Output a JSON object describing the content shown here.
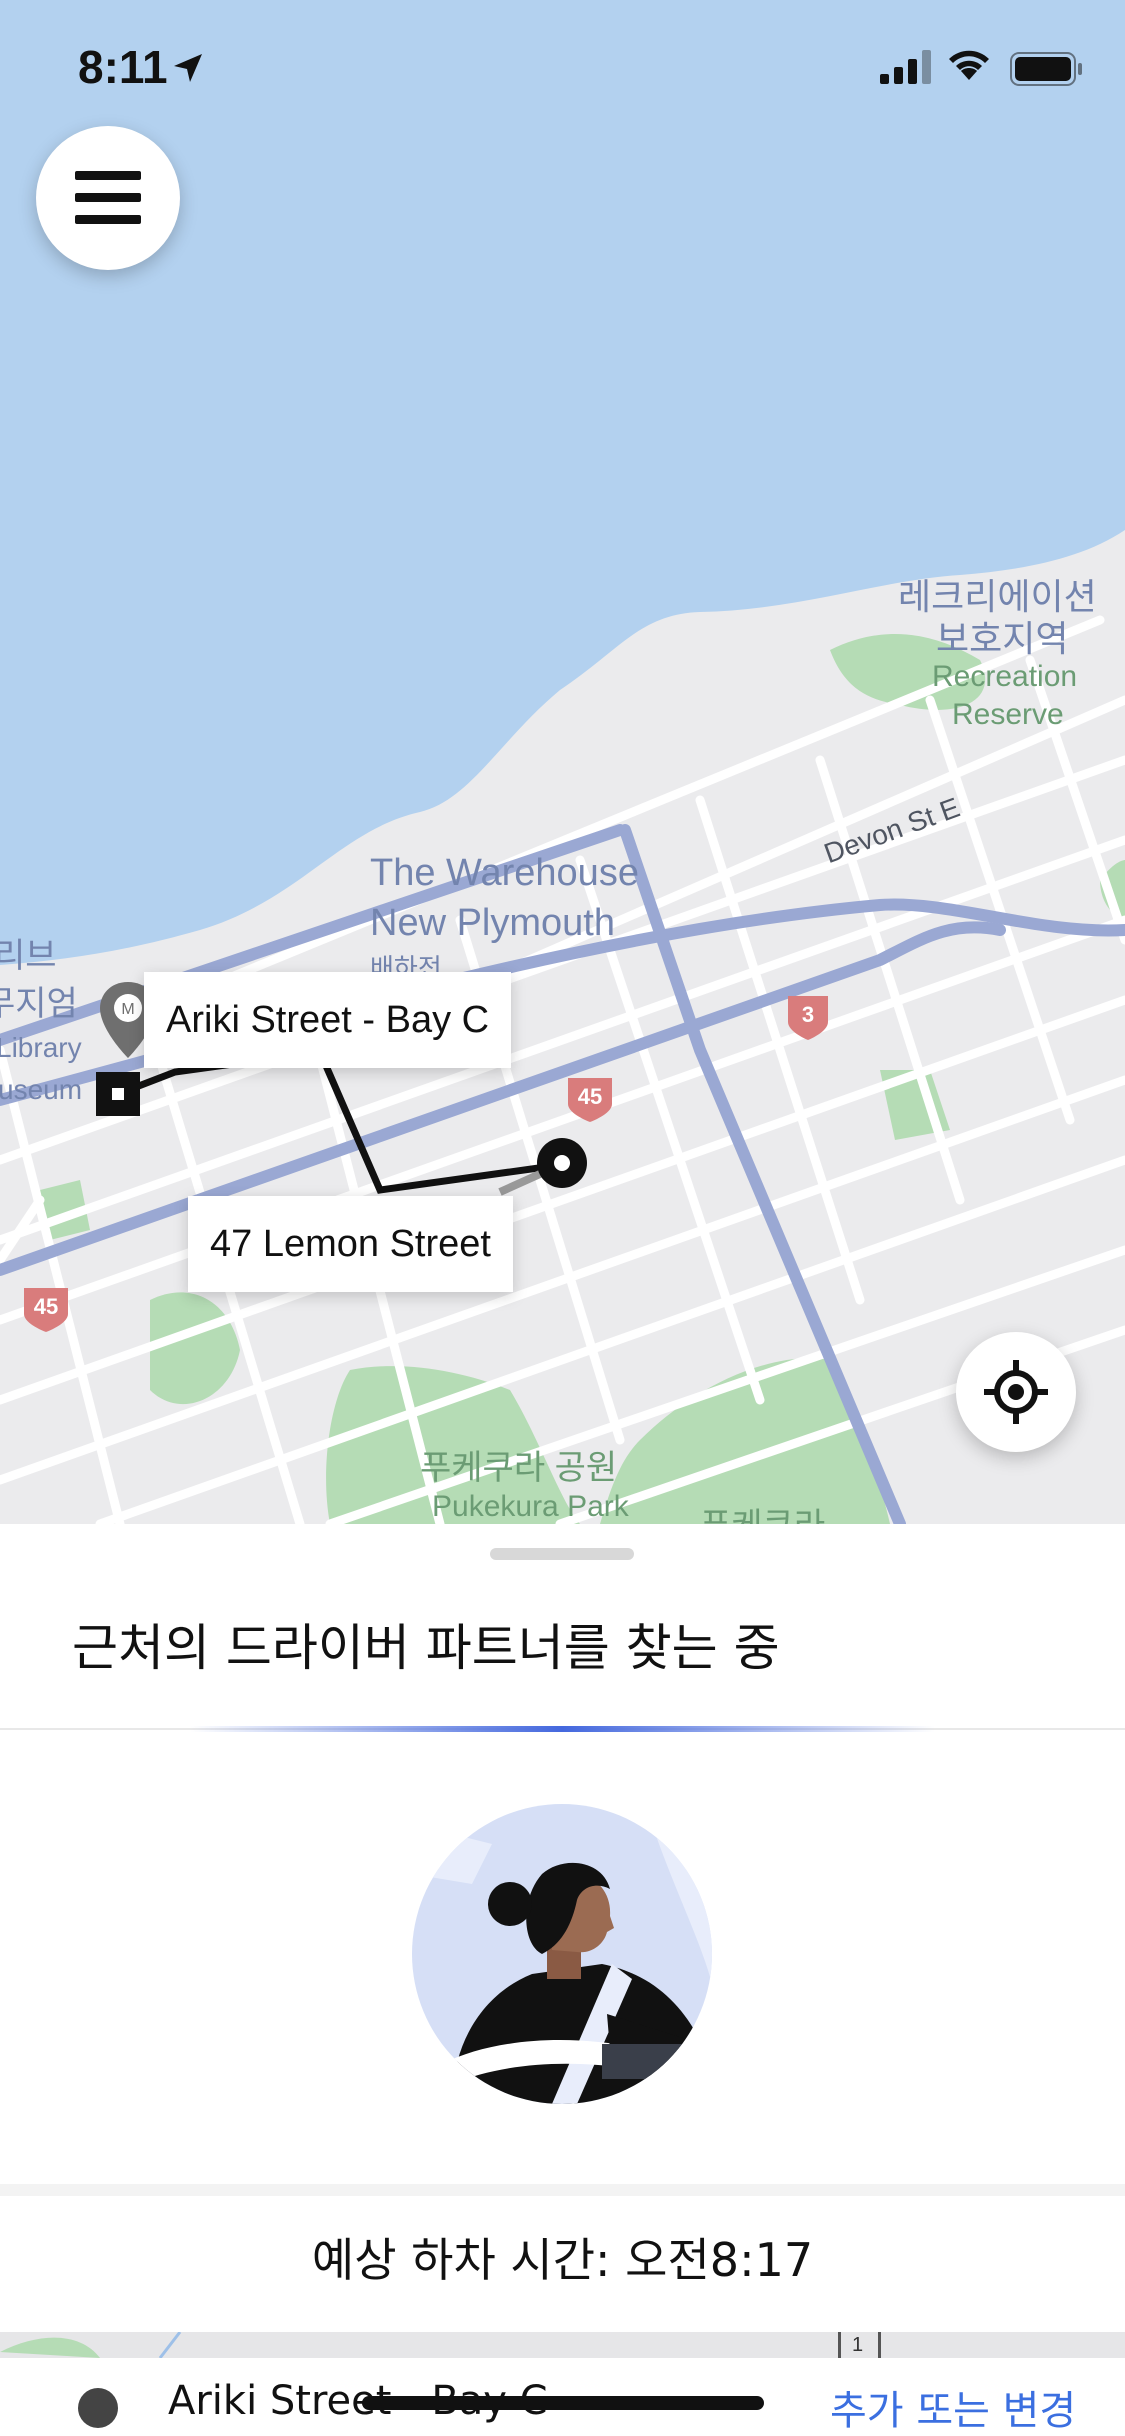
{
  "status_bar": {
    "time": "8:11",
    "icons": [
      "location-arrow-icon",
      "cellular-signal-icon",
      "wifi-icon",
      "battery-icon"
    ]
  },
  "map": {
    "labels": {
      "recreation_reserve_ko_1": "레크리에이션",
      "recreation_reserve_ko_2": "보호지역",
      "recreation_1": "Recreation",
      "recreation_2": "Reserve",
      "warehouse_1": "The Warehouse",
      "warehouse_2": "New Plymouth",
      "warehouse_ko": "배하전",
      "devon_st": "Devon St E",
      "library_ko_1": "리브",
      "library_ko_2": "무지엄",
      "library_1": "Library",
      "library_2": "useum",
      "library_marker": "M",
      "park_ko": "푸케쿠라 공원",
      "park": "Pukekura Park",
      "park_ko_partial": "푸케쿠라"
    },
    "route_shields": [
      "3",
      "45",
      "45"
    ],
    "pickup_callout": "Ariki Street - Bay C",
    "dropoff_callout": "47 Lemon Street",
    "colors": {
      "water": "#b3d1ef",
      "land": "#ebebed",
      "park": "#b5dcb5",
      "highway": "#9aa8d3",
      "route": "#111111"
    }
  },
  "buttons": {
    "menu": "menu-icon",
    "locate": "crosshair-icon"
  },
  "sheet": {
    "title": "근처의 드라이버 파트너를 찾는 중",
    "eta": "예상 하차 시간: 오전8:17",
    "mini_map_label": "1",
    "address": "Ariki Street - Bay C",
    "change_link": "추가 또는 변경"
  },
  "colors": {
    "accent": "#4468de",
    "link": "#3b6fe0"
  }
}
